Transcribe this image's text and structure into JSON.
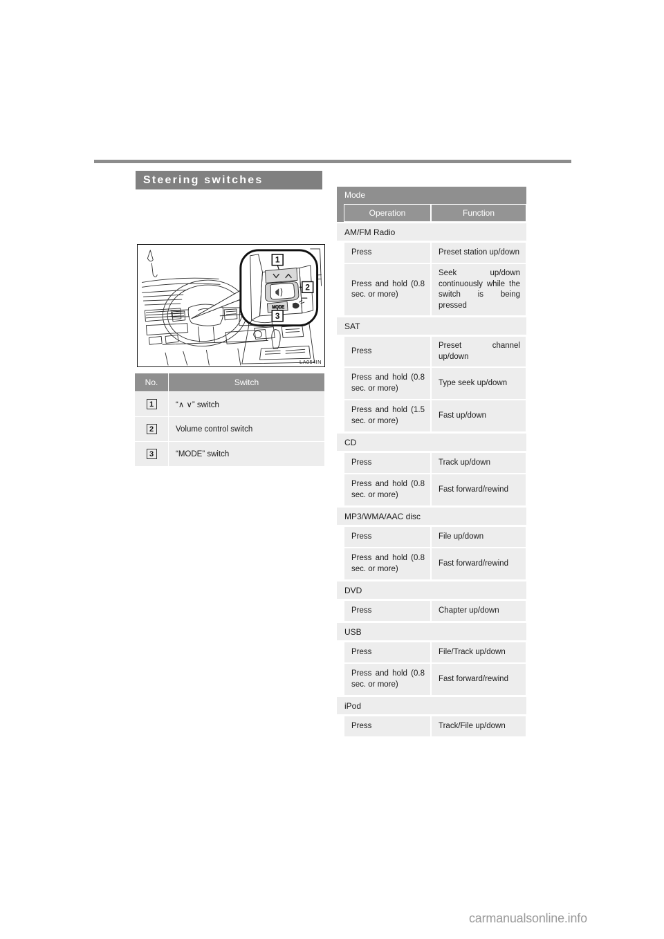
{
  "page": {
    "section_title": "Steering switches",
    "watermark": "carmanualsonline.info"
  },
  "illustration": {
    "code": "LA054IN",
    "callout_labels": [
      "1",
      "2",
      "3"
    ],
    "alt": "Steering wheel with audio control switches callout"
  },
  "switch_table": {
    "headers": {
      "no": "No.",
      "switch": "Switch"
    },
    "rows": [
      {
        "no": "1",
        "label": "“∧ ∨” switch"
      },
      {
        "no": "2",
        "label": "Volume control switch"
      },
      {
        "no": "3",
        "label": "“MODE” switch"
      }
    ]
  },
  "mode_table": {
    "title": "Mode",
    "subheaders": {
      "operation": "Operation",
      "function": "Function"
    },
    "sections": [
      {
        "mode": "AM/FM Radio",
        "rows": [
          {
            "operation": "Press",
            "function": "Preset station up/down",
            "lines": 2
          },
          {
            "operation": "Press and hold (0.8 sec. or more)",
            "function": "Seek up/down continuously while the switch is being pressed",
            "lines": 4
          }
        ]
      },
      {
        "mode": "SAT",
        "rows": [
          {
            "operation": "Press",
            "function": "Preset channel up/down",
            "lines": 2
          },
          {
            "operation": "Press and hold (0.8 sec. or more)",
            "function": "Type seek up/down",
            "lines": 3
          },
          {
            "operation": "Press and hold (1.5 sec. or more)",
            "function": "Fast up/down",
            "lines": 3
          }
        ]
      },
      {
        "mode": "CD",
        "rows": [
          {
            "operation": "Press",
            "function": "Track up/down",
            "lines": 1
          },
          {
            "operation": "Press and hold (0.8 sec. or more)",
            "function": "Fast forward/rewind",
            "lines": 3
          }
        ]
      },
      {
        "mode": "MP3/WMA/AAC disc",
        "rows": [
          {
            "operation": "Press",
            "function": "File up/down",
            "lines": 1
          },
          {
            "operation": "Press and hold (0.8 sec. or more)",
            "function": "Fast forward/rewind",
            "lines": 3
          }
        ]
      },
      {
        "mode": "DVD",
        "rows": [
          {
            "operation": "Press",
            "function": "Chapter up/down",
            "lines": 1
          }
        ]
      },
      {
        "mode": "USB",
        "rows": [
          {
            "operation": "Press",
            "function": "File/Track up/down",
            "lines": 1
          },
          {
            "operation": "Press and hold (0.8 sec. or more)",
            "function": "Fast forward/rewind",
            "lines": 3
          }
        ]
      },
      {
        "mode": "iPod",
        "rows": [
          {
            "operation": "Press",
            "function": "Track/File up/down",
            "lines": 1
          }
        ]
      }
    ]
  },
  "colors": {
    "header_gray": "#8f8f8f",
    "cell_gray": "#ededed",
    "rule_gray": "#8c8c8c",
    "watermark_gray": "#9a9a9a"
  }
}
